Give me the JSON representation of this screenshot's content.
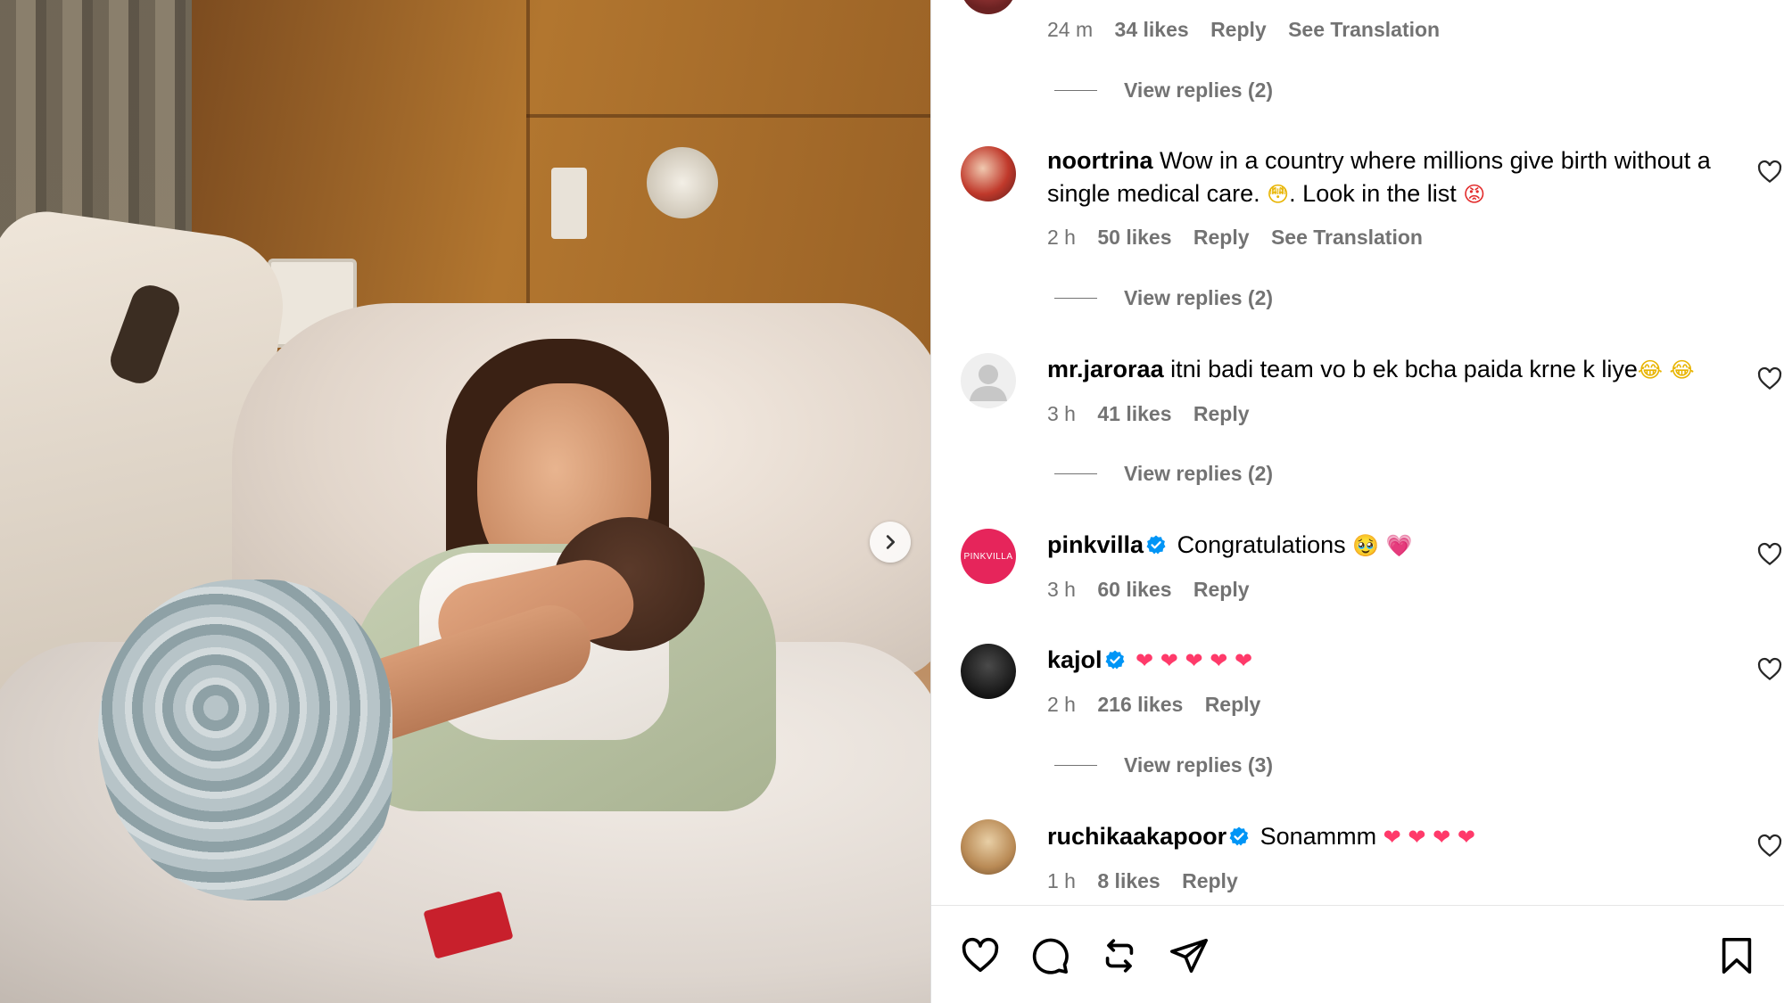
{
  "post": {
    "next_button_icon": "chevron-right-icon"
  },
  "comments": [
    {
      "username": "",
      "text": "",
      "time": "24 m",
      "likes": "34 likes",
      "reply_label": "Reply",
      "translate_label": "See Translation",
      "view_replies": "View replies (2)"
    },
    {
      "username": "noortrina",
      "text": "Wow in a country where millions give birth without a single medical care.",
      "text_2": ". Look in the list",
      "emoji_1": "😳",
      "emoji_2": "😡",
      "time": "2 h",
      "likes": "50 likes",
      "reply_label": "Reply",
      "translate_label": "See Translation",
      "view_replies": "View replies (2)"
    },
    {
      "username": "mr.jaroraa",
      "text": "itni badi team vo b ek bcha paida krne k liye",
      "emoji_1": "😂",
      "emoji_2": "😂",
      "time": "3 h",
      "likes": "41 likes",
      "reply_label": "Reply",
      "view_replies": "View replies (2)"
    },
    {
      "username": "pinkvilla",
      "avatar_text": "PINKVILLA",
      "text": "Congratulations",
      "emoji_1": "🥹",
      "emoji_2": "💗",
      "time": "3 h",
      "likes": "60 likes",
      "reply_label": "Reply"
    },
    {
      "username": "kajol",
      "text": "",
      "emojis": "❤ ❤ ❤ ❤ ❤",
      "time": "2 h",
      "likes": "216 likes",
      "reply_label": "Reply",
      "view_replies": "View replies (3)"
    },
    {
      "username": "ruchikaakapoor",
      "text": "Sonammm",
      "emojis": "❤ ❤ ❤ ❤",
      "time": "1 h",
      "likes": "8 likes",
      "reply_label": "Reply"
    }
  ],
  "colors": {
    "meta_gray": "#737373",
    "verified_blue": "#0095f6",
    "pinkvilla_brand": "#e6255b"
  },
  "actions": {
    "icons": [
      "heart-icon",
      "comment-icon",
      "repost-icon",
      "share-icon",
      "bookmark-icon"
    ]
  }
}
